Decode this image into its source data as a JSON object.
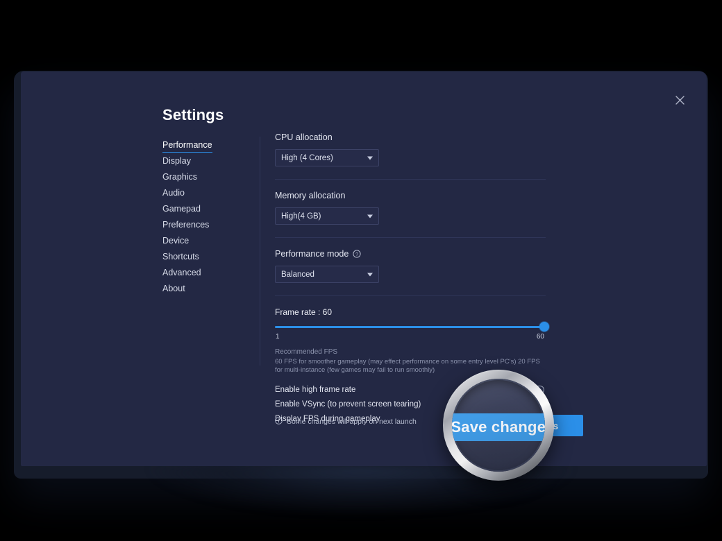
{
  "window": {
    "title": "Settings",
    "close_icon": "close-icon"
  },
  "sidebar": {
    "items": [
      {
        "label": "Performance",
        "active": true
      },
      {
        "label": "Display",
        "active": false
      },
      {
        "label": "Graphics",
        "active": false
      },
      {
        "label": "Audio",
        "active": false
      },
      {
        "label": "Gamepad",
        "active": false
      },
      {
        "label": "Preferences",
        "active": false
      },
      {
        "label": "Device",
        "active": false
      },
      {
        "label": "Shortcuts",
        "active": false
      },
      {
        "label": "Advanced",
        "active": false
      },
      {
        "label": "About",
        "active": false
      }
    ]
  },
  "settings": {
    "cpu": {
      "label": "CPU allocation",
      "value": "High (4 Cores)",
      "options": [
        "High (4 Cores)"
      ]
    },
    "memory": {
      "label": "Memory allocation",
      "value": "High(4 GB)",
      "options": [
        "High(4 GB)"
      ]
    },
    "performance_mode": {
      "label": "Performance mode",
      "value": "Balanced",
      "options": [
        "Balanced"
      ],
      "help_icon": "question-circle-icon"
    },
    "frame_rate": {
      "title": "Frame rate : 60",
      "value": 60,
      "min": 1,
      "max": 60,
      "min_label": "1",
      "max_label": "60",
      "fill_percent": 100,
      "accent_color": "#2b8fe8"
    },
    "recommended": {
      "heading": "Recommended FPS",
      "body": "60 FPS for smoother gameplay (may effect performance on some entry level PC's) 20 FPS for multi-instance (few games may fail to run smoothly)"
    },
    "toggles": [
      {
        "label": "Enable high frame rate",
        "on": false
      },
      {
        "label": "Enable VSync (to prevent screen tearing)",
        "on": false
      },
      {
        "label": "Display FPS during gameplay",
        "on": false
      }
    ]
  },
  "footer": {
    "note": "Some changes will apply on next launch",
    "note_icon": "info-circle-icon",
    "save_label": "Save changes"
  },
  "magnifier": {
    "magnified_label": "Save changes",
    "icon": "magnifier-lens"
  },
  "colors": {
    "accent": "#2b8fe8",
    "panel_bg": "#232844",
    "frame_bg": "#161c2b",
    "backdrop": "#000000"
  }
}
